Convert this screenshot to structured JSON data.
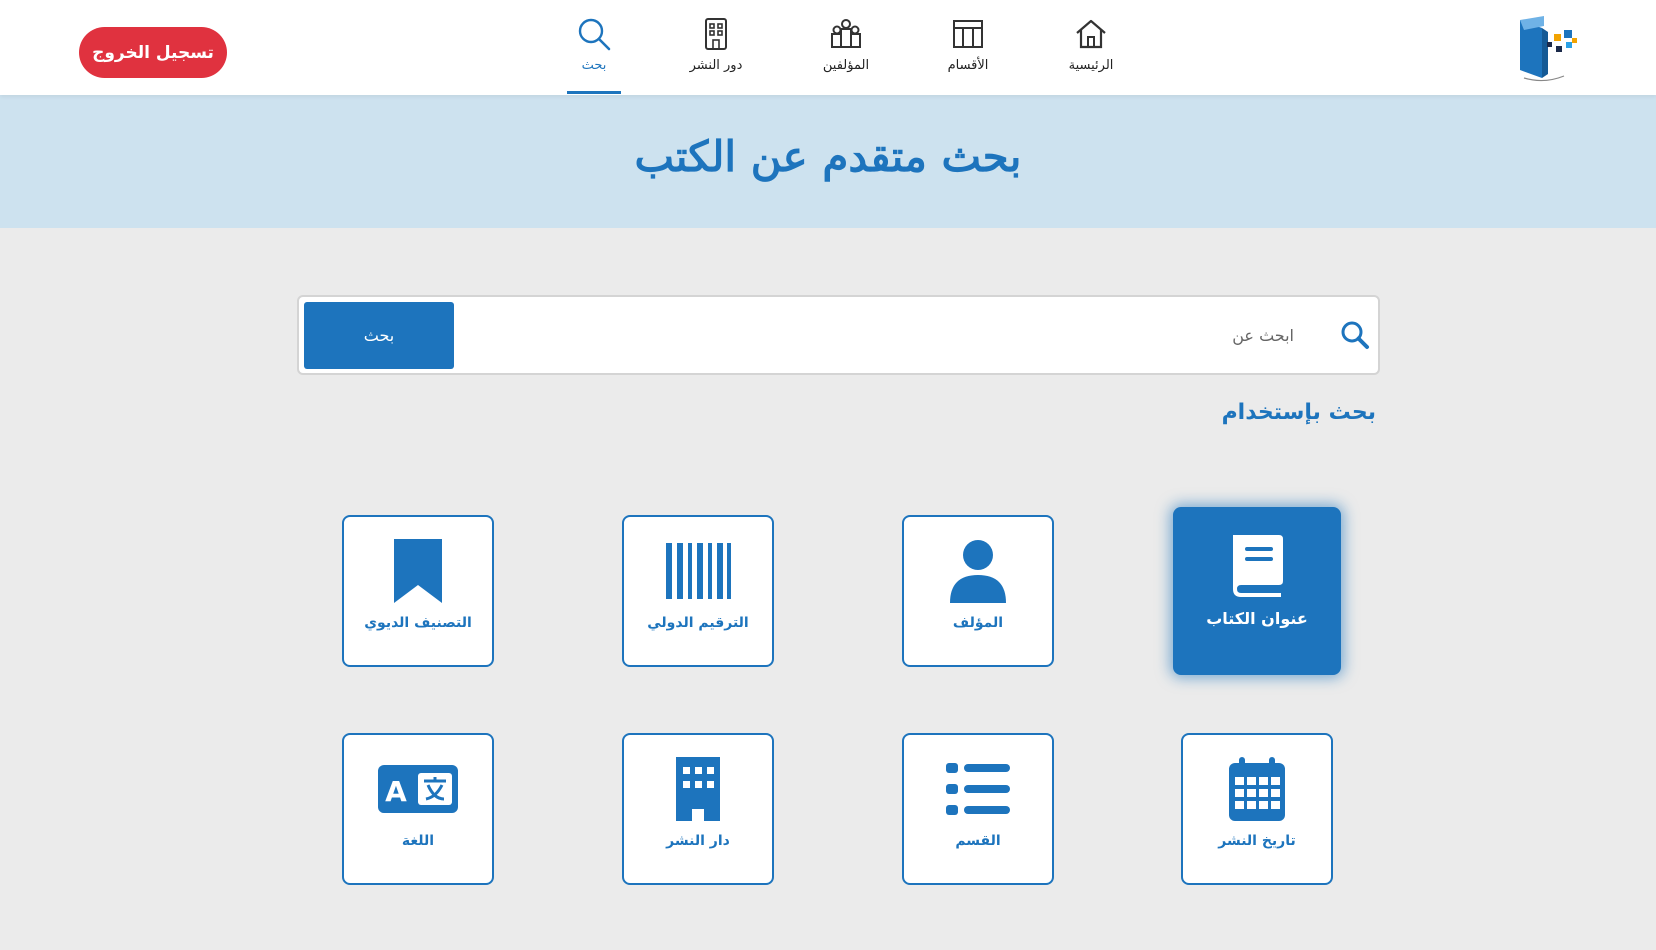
{
  "header": {
    "logout_label": "تسجيل الخروج",
    "nav": [
      {
        "label": "بحث",
        "icon": "search-icon",
        "active": true
      },
      {
        "label": "دور النشر",
        "icon": "building-icon",
        "active": false
      },
      {
        "label": "المؤلفين",
        "icon": "people-icon",
        "active": false
      },
      {
        "label": "الأقسام",
        "icon": "table-icon",
        "active": false
      },
      {
        "label": "الرئيسية",
        "icon": "home-icon",
        "active": false
      }
    ]
  },
  "hero": {
    "title": "بحث متقدم عن الكتب"
  },
  "search": {
    "placeholder": "ابحث عن",
    "value": "",
    "button_label": "بحث"
  },
  "section_title": "بحث بإستخدام",
  "cards": [
    {
      "label": "عنوان الكتاب",
      "icon": "book-icon",
      "selected": true
    },
    {
      "label": "المؤلف",
      "icon": "user-icon",
      "selected": false
    },
    {
      "label": "الترقيم الدولي",
      "icon": "barcode-icon",
      "selected": false
    },
    {
      "label": "التصنيف الديوي",
      "icon": "bookmark-icon",
      "selected": false
    },
    {
      "label": "تاريخ النشر",
      "icon": "calendar-icon",
      "selected": false
    },
    {
      "label": "القسم",
      "icon": "list-icon",
      "selected": false
    },
    {
      "label": "دار النشر",
      "icon": "building-icon",
      "selected": false
    },
    {
      "label": "اللغة",
      "icon": "language-icon",
      "selected": false
    }
  ],
  "colors": {
    "primary": "#1d74bd",
    "danger": "#e0323f",
    "hero_bg": "#cde2ef",
    "page_bg": "#ebebeb"
  }
}
